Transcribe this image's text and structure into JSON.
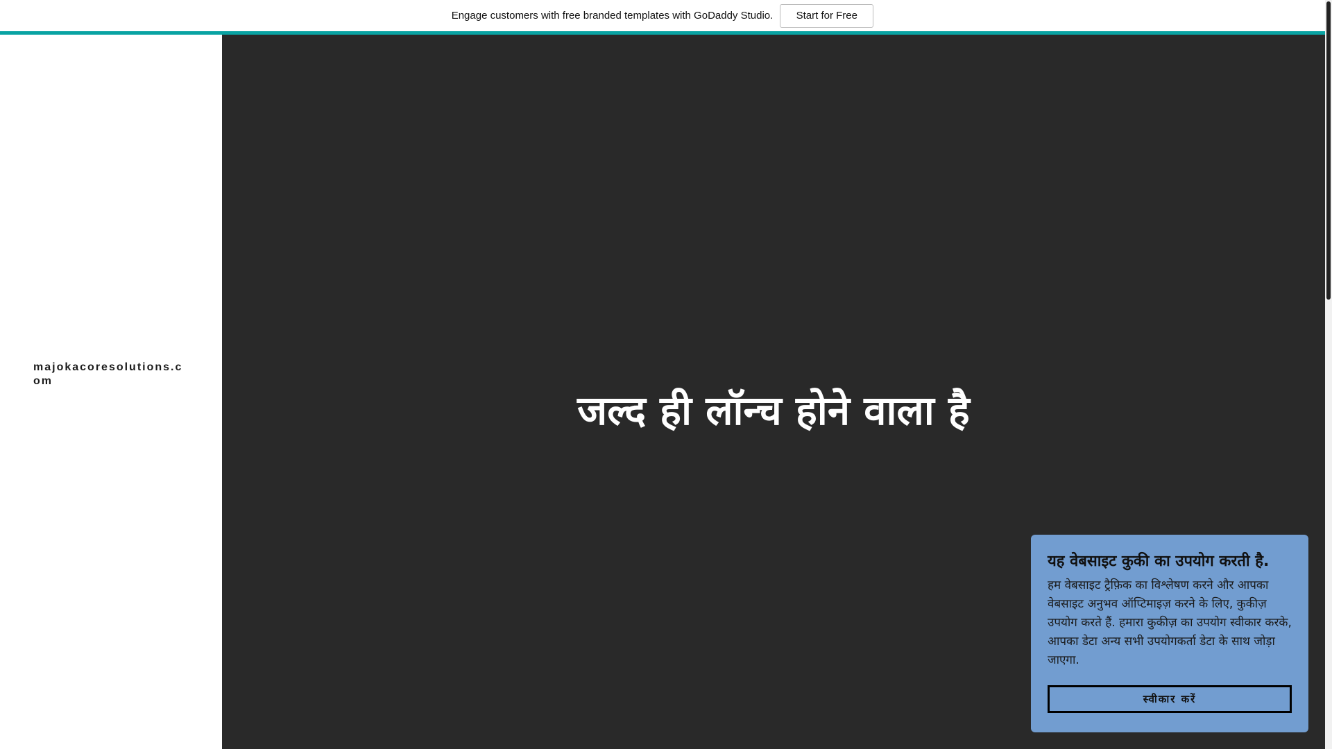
{
  "banner": {
    "message": "Engage customers with free branded templates with GoDaddy Studio.",
    "cta_label": "Start for Free"
  },
  "sidebar": {
    "site_name": "majokacoresolutions.com"
  },
  "main": {
    "headline": "जल्द ही लॉन्च होने वाला है"
  },
  "cookie": {
    "title": "यह वेबसाइट कुकी का उपयोग करती है.",
    "body": "हम वेबसाइट ट्रैफ़िक का विश्लेषण करने और आपका वेबसाइट अनुभव ऑप्टिमाइज़ करने के लिए, कुकीज़ उपयोग करते हैं. हमारा कुकीज़ का उपयोग स्वीकार करके, आपका डेटा अन्य सभी उपयोगकर्ता डेटा के साथ जोड़ा जाएगा.",
    "accept_label": "स्वीकार करें"
  },
  "colors": {
    "accent": "#09a3a3",
    "background": "#292929",
    "cookie_bg": "#729dd0"
  }
}
